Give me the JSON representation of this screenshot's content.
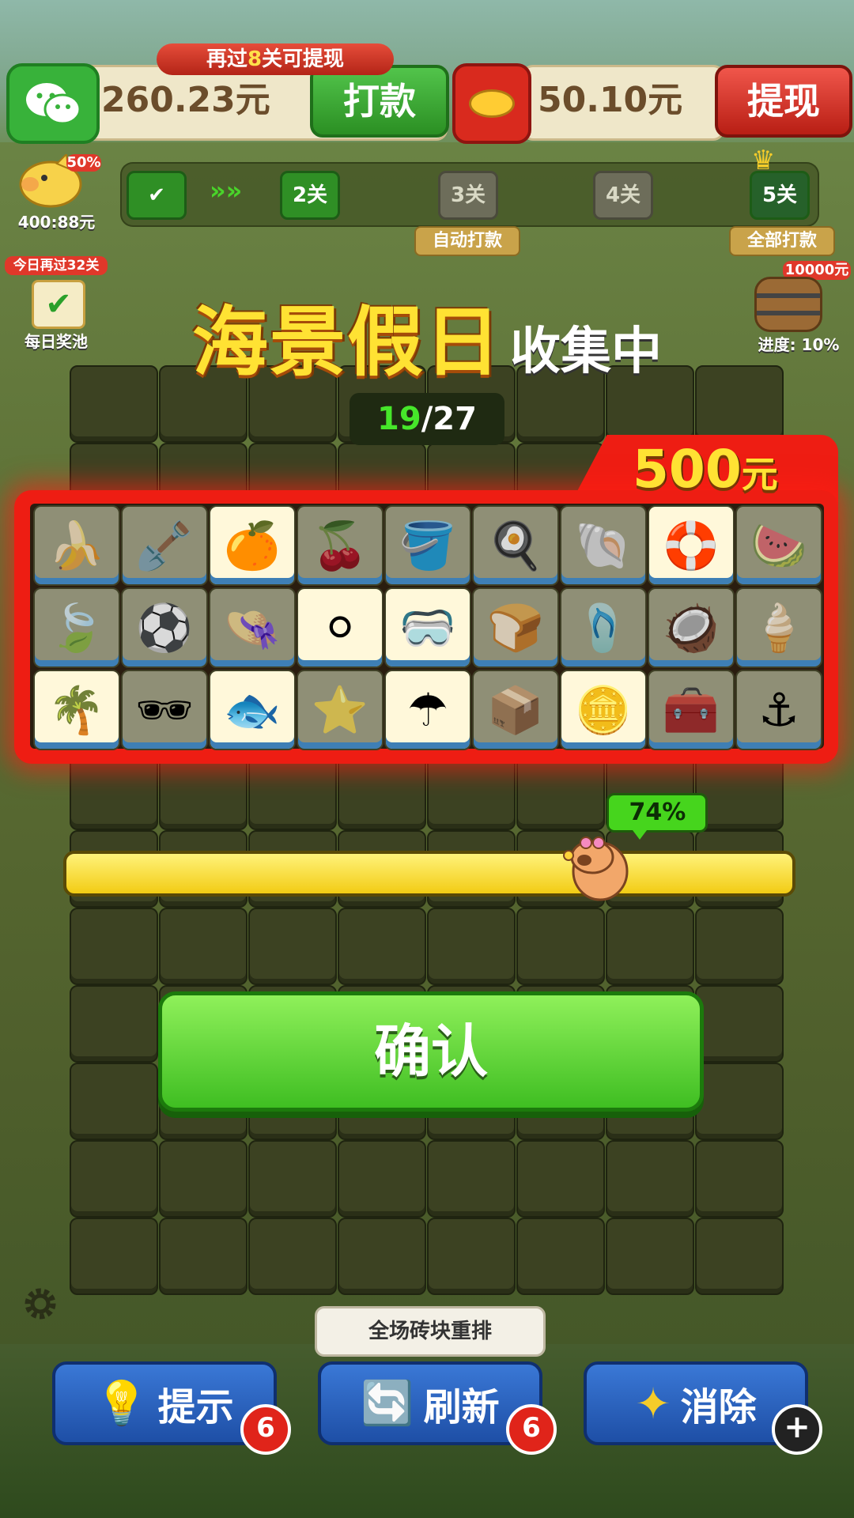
{
  "header": {
    "progress_hint": {
      "prefix": "再过",
      "count": "8",
      "suffix": "关可提现"
    },
    "wechat_amount": "260.23元",
    "pay_button": "打款",
    "redpack_amount": "50.10元",
    "withdraw_button": "提现"
  },
  "piggy": {
    "percent": "50%",
    "amount": "400:88元"
  },
  "levels": {
    "items": [
      "2关",
      "3关",
      "4关",
      "5关"
    ],
    "auto_pay_label": "自动打款",
    "all_pay_label": "全部打款"
  },
  "daily_pool": {
    "badge": "今日再过32关",
    "label": "每日奖池"
  },
  "barrel": {
    "badge": "10000元",
    "label": "进度: 10%"
  },
  "collection": {
    "title_main": "海景假日",
    "title_sub": "收集中",
    "counter_current": "19",
    "counter_total": "/27",
    "prize_amount": "500",
    "prize_unit": "元",
    "items": [
      {
        "icon": "banana-icon",
        "glyph": "🍌",
        "collected": false
      },
      {
        "icon": "shovel-icon",
        "glyph": "🪏",
        "collected": false
      },
      {
        "icon": "orange-icon",
        "glyph": "🍊",
        "collected": true
      },
      {
        "icon": "cherry-icon",
        "glyph": "🍒",
        "collected": false
      },
      {
        "icon": "bucket-icon",
        "glyph": "🪣",
        "collected": false
      },
      {
        "icon": "pan-icon",
        "glyph": "🍳",
        "collected": false
      },
      {
        "icon": "shell-icon",
        "glyph": "🐚",
        "collected": false
      },
      {
        "icon": "swim-ring-icon",
        "glyph": "🛟",
        "collected": true
      },
      {
        "icon": "watermelon-icon",
        "glyph": "🍉",
        "collected": false
      },
      {
        "icon": "leaf-icon",
        "glyph": "🍃",
        "collected": false
      },
      {
        "icon": "beach-ball-icon",
        "glyph": "⚽",
        "collected": false
      },
      {
        "icon": "straw-hat-icon",
        "glyph": "👒",
        "collected": false
      },
      {
        "icon": "pearl-icon",
        "glyph": "⚪",
        "collected": true
      },
      {
        "icon": "goggles-icon",
        "glyph": "🥽",
        "collected": true
      },
      {
        "icon": "bread-icon",
        "glyph": "🍞",
        "collected": false
      },
      {
        "icon": "flip-flop-icon",
        "glyph": "🩴",
        "collected": false
      },
      {
        "icon": "coconut-icon",
        "glyph": "🥥",
        "collected": false
      },
      {
        "icon": "ice-cream-icon",
        "glyph": "🍦",
        "collected": false
      },
      {
        "icon": "palm-tree-icon",
        "glyph": "🌴",
        "collected": true
      },
      {
        "icon": "sunglasses-icon",
        "glyph": "🕶",
        "collected": false
      },
      {
        "icon": "fish-icon",
        "glyph": "🐟",
        "collected": true
      },
      {
        "icon": "starfish-icon",
        "glyph": "⭐",
        "collected": false
      },
      {
        "icon": "umbrella-icon",
        "glyph": "☂",
        "collected": true
      },
      {
        "icon": "crate-icon",
        "glyph": "📦",
        "collected": false
      },
      {
        "icon": "coin-icon",
        "glyph": "🪙",
        "collected": true
      },
      {
        "icon": "treasure-chest-icon",
        "glyph": "🧰",
        "collected": false
      },
      {
        "icon": "anchor-icon",
        "glyph": "⚓",
        "collected": false
      }
    ]
  },
  "progress": {
    "percent_label": "74%",
    "fraction": 0.74
  },
  "confirm_button": "确认",
  "reshuffle_tip": "全场砖块重排",
  "tools": {
    "hint": {
      "label": "提示",
      "count": "6"
    },
    "refresh": {
      "label": "刷新",
      "count": "6"
    },
    "eliminate": {
      "label": "消除",
      "add": "+"
    }
  },
  "colors": {
    "accent_green": "#3fbe22",
    "panel_red": "#ee1d13",
    "title_yellow": "#ffe233"
  }
}
